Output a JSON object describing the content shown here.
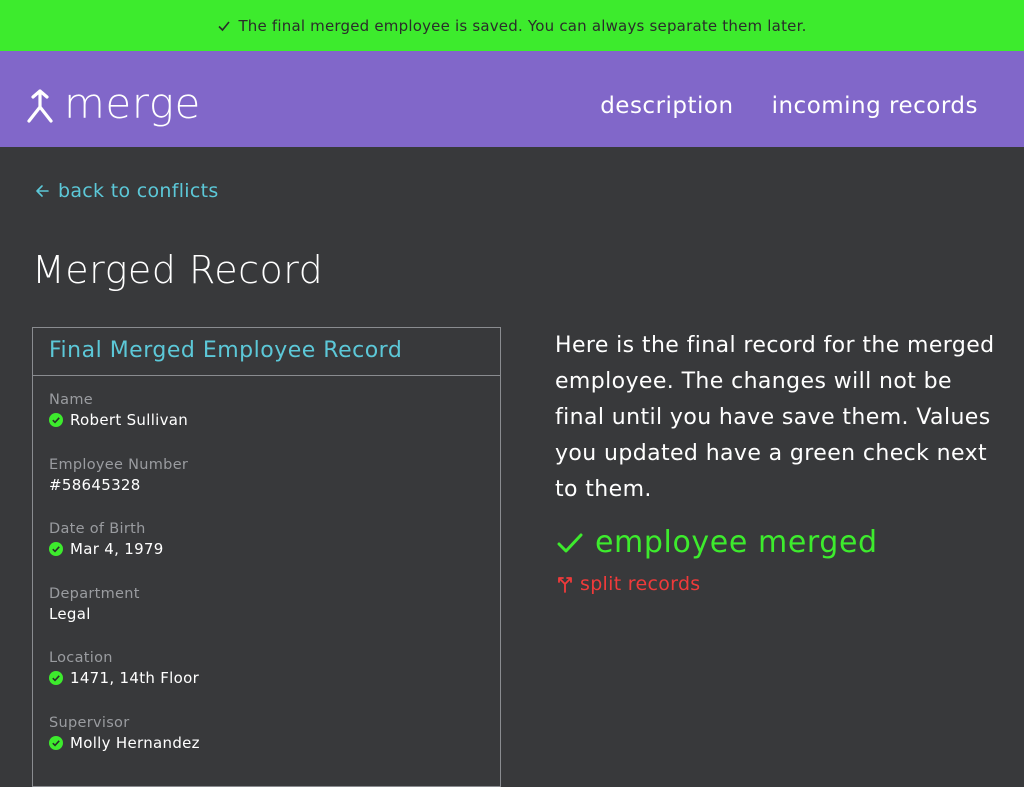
{
  "banner": {
    "message": "The final merged employee is saved. You can always separate them later.",
    "icon": "check-icon",
    "color": "#3deb2d"
  },
  "header": {
    "brand": "merge",
    "brand_icon": "merge-icon",
    "color": "#8167c9",
    "nav": [
      {
        "label": "description"
      },
      {
        "label": "incoming records"
      }
    ]
  },
  "back_link": {
    "label": "back to conflicts",
    "icon": "arrow-left-icon"
  },
  "page_title": "Merged Record",
  "record": {
    "title": "Final Merged Employee Record",
    "fields": [
      {
        "label": "Name",
        "value": "Robert Sullivan",
        "updated": true
      },
      {
        "label": "Employee Number",
        "value": "#58645328",
        "updated": false
      },
      {
        "label": "Date of Birth",
        "value": "Mar 4, 1979",
        "updated": true
      },
      {
        "label": "Department",
        "value": "Legal",
        "updated": false
      },
      {
        "label": "Location",
        "value": "1471, 14th Floor",
        "updated": true
      },
      {
        "label": "Supervisor",
        "value": "Molly Hernandez",
        "updated": true
      }
    ]
  },
  "description": "Here is the final record for the merged employee. The changes will not be final until you have save them. Values you updated have a green check next to them.",
  "status": {
    "label": "employee merged",
    "icon": "check-icon",
    "color": "#3deb2d"
  },
  "split_link": {
    "label": "split records",
    "icon": "split-icon",
    "color": "#f03a3a"
  }
}
